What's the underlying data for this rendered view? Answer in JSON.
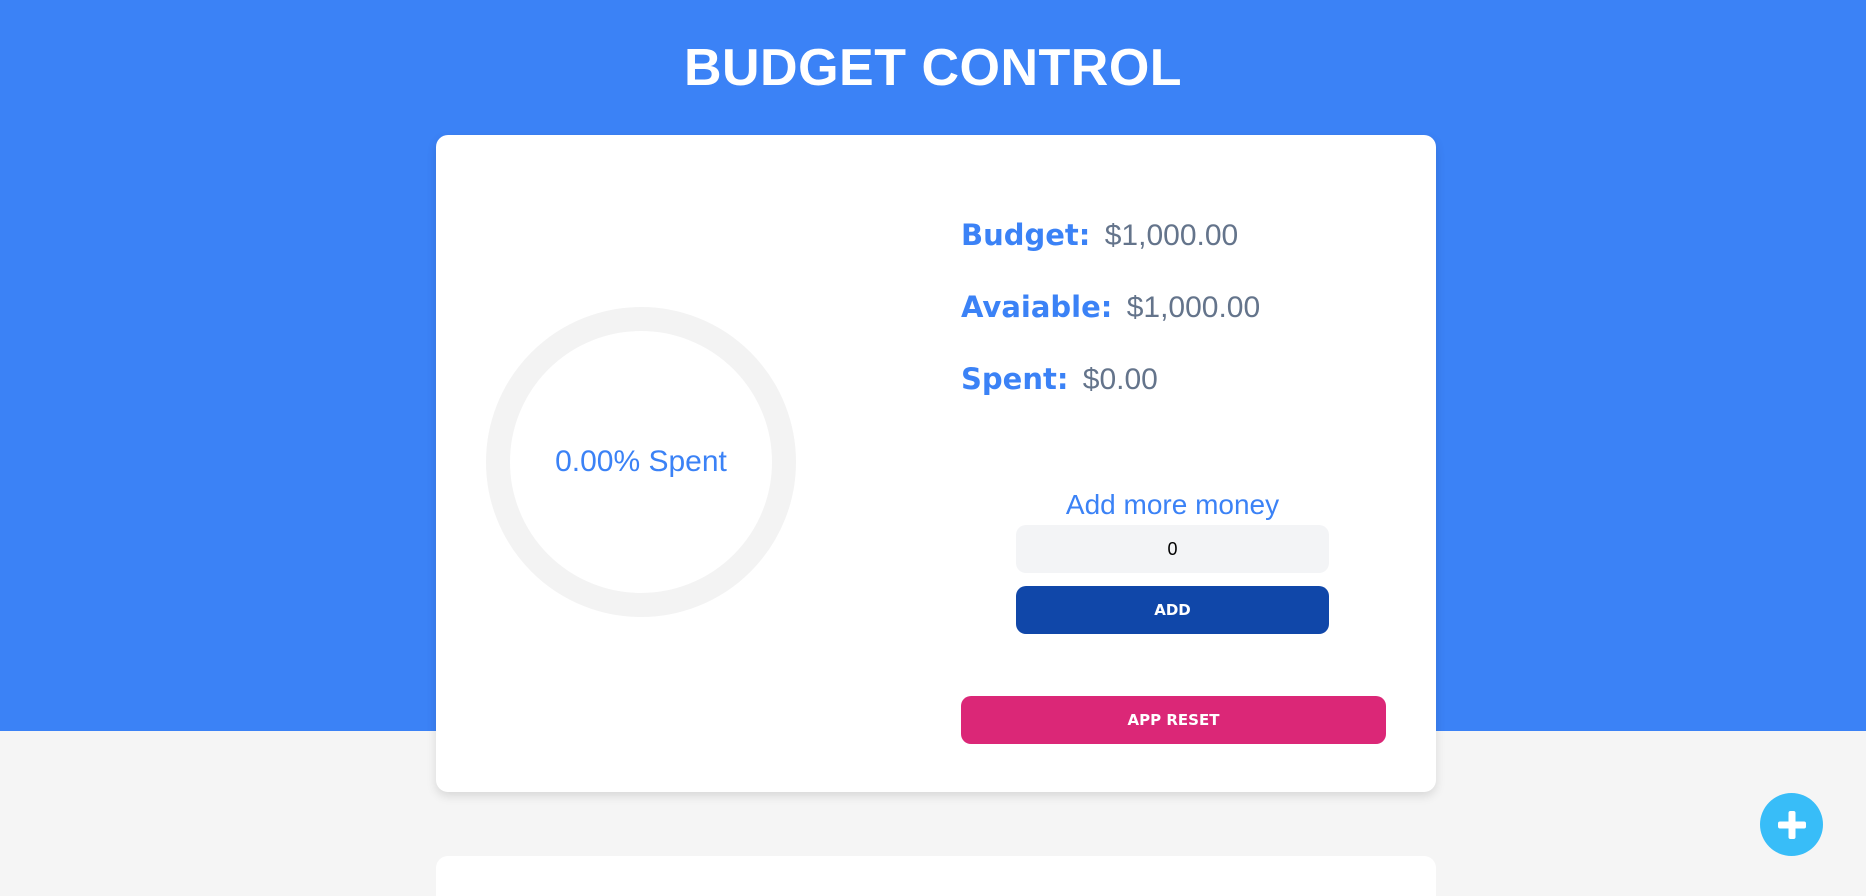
{
  "header": {
    "title": "BUDGET CONTROL"
  },
  "summary": {
    "progress_text": "0.00% Spent",
    "progress_fraction": 0,
    "budget_label": "Budget:",
    "budget_value": "$1,000.00",
    "available_label": "Avaiable:",
    "available_value": "$1,000.00",
    "spent_label": "Spent:",
    "spent_value": "$0.00"
  },
  "add_money": {
    "label": "Add more money",
    "value": "0",
    "button_label": "ADD"
  },
  "reset": {
    "button_label": "APP RESET"
  },
  "fab": {
    "icon": "plus-icon"
  },
  "colors": {
    "primary": "#3b82f6",
    "add_button": "#1047a9",
    "reset_button": "#db2777",
    "fab": "#38bdf8",
    "track": "#f3f3f3",
    "value_text": "#64748b"
  }
}
